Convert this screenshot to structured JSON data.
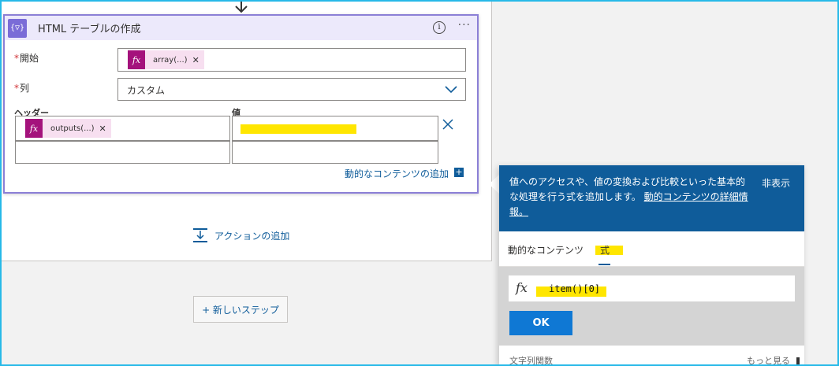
{
  "card": {
    "icon": "{▽}",
    "title": "HTML テーブルの作成",
    "info": "i",
    "more": "···"
  },
  "fields": {
    "start_label": "開始",
    "start_token": "array(...)",
    "column_label": "列",
    "column_value": "カスタム"
  },
  "table": {
    "header_col": "ヘッダー",
    "value_col": "値",
    "header_token": "outputs(...)"
  },
  "dynamic_content_link": "動的なコンテンツの追加",
  "add_action": "アクションの追加",
  "new_step": "+ 新しいステップ",
  "popup": {
    "text_main": "値へのアクセスや、値の変換および比較といった基本的な処理を行う式を追加します。",
    "text_link": "動的コンテンツの詳細情報。",
    "hide": "非表示",
    "tab_dynamic": "動的なコンテンツ",
    "tab_expression": "式",
    "expression": "item()[0]",
    "fx": "fx",
    "ok": "OK",
    "section_label": "文字列関数",
    "see_more": "もっと見る"
  },
  "colors": {
    "accent": "#0f5c9a",
    "card_border": "#8b7fd6",
    "token_fx": "#a4127c",
    "highlight": "#ffe600"
  }
}
